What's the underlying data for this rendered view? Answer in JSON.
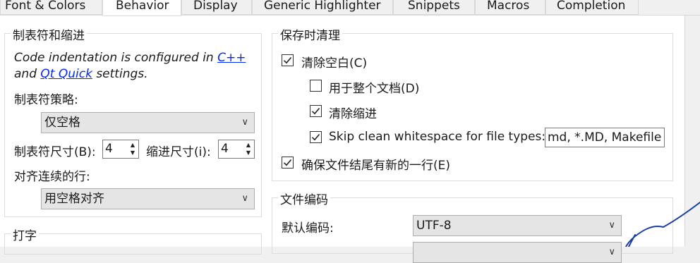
{
  "tabs": [
    {
      "label": "Font & Colors"
    },
    {
      "label": "Behavior"
    },
    {
      "label": "Display"
    },
    {
      "label": "Generic Highlighter"
    },
    {
      "label": "Snippets"
    },
    {
      "label": "Macros"
    },
    {
      "label": "Completion"
    }
  ],
  "active_tab": "Behavior",
  "tabs_group": {
    "title": "制表符和缩进",
    "info_line1_prefix": "Code indentation is configured in ",
    "info_link_cpp": "C++",
    "info_line2_prefix": "and ",
    "info_link_qtquick": "Qt Quick",
    "info_line2_suffix": " settings.",
    "tab_policy_label": "制表符策略:",
    "tab_policy_value": "仅空格",
    "tab_size_label": "制表符尺寸(B):",
    "tab_size_value": "4",
    "indent_size_label": "缩进尺寸(i):",
    "indent_size_value": "4",
    "align_label": "对齐连续的行:",
    "align_value": "用空格对齐"
  },
  "typing_group": {
    "title": "打字"
  },
  "cleanup_group": {
    "title": "保存时清理",
    "clean_whitespace": {
      "label": "清除空白(C)",
      "checked": true
    },
    "entire_document": {
      "label": "用于整个文档(D)",
      "checked": false
    },
    "clean_indentation": {
      "label": "清除缩进",
      "checked": true
    },
    "skip_clean": {
      "label": "Skip clean whitespace for file types:",
      "checked": true,
      "value": "md, *.MD, Makefile"
    },
    "ensure_newline": {
      "label": "确保文件结尾有新的一行(E)",
      "checked": true
    }
  },
  "encoding_group": {
    "title": "文件编码",
    "default_encoding_label": "默认编码:",
    "default_encoding_value": "UTF-8"
  },
  "icons": {
    "combo_arrow": "chevron-down-icon",
    "checkmark": "checkmark-icon",
    "spin_up": "spin-up-icon",
    "spin_down": "spin-down-icon"
  }
}
